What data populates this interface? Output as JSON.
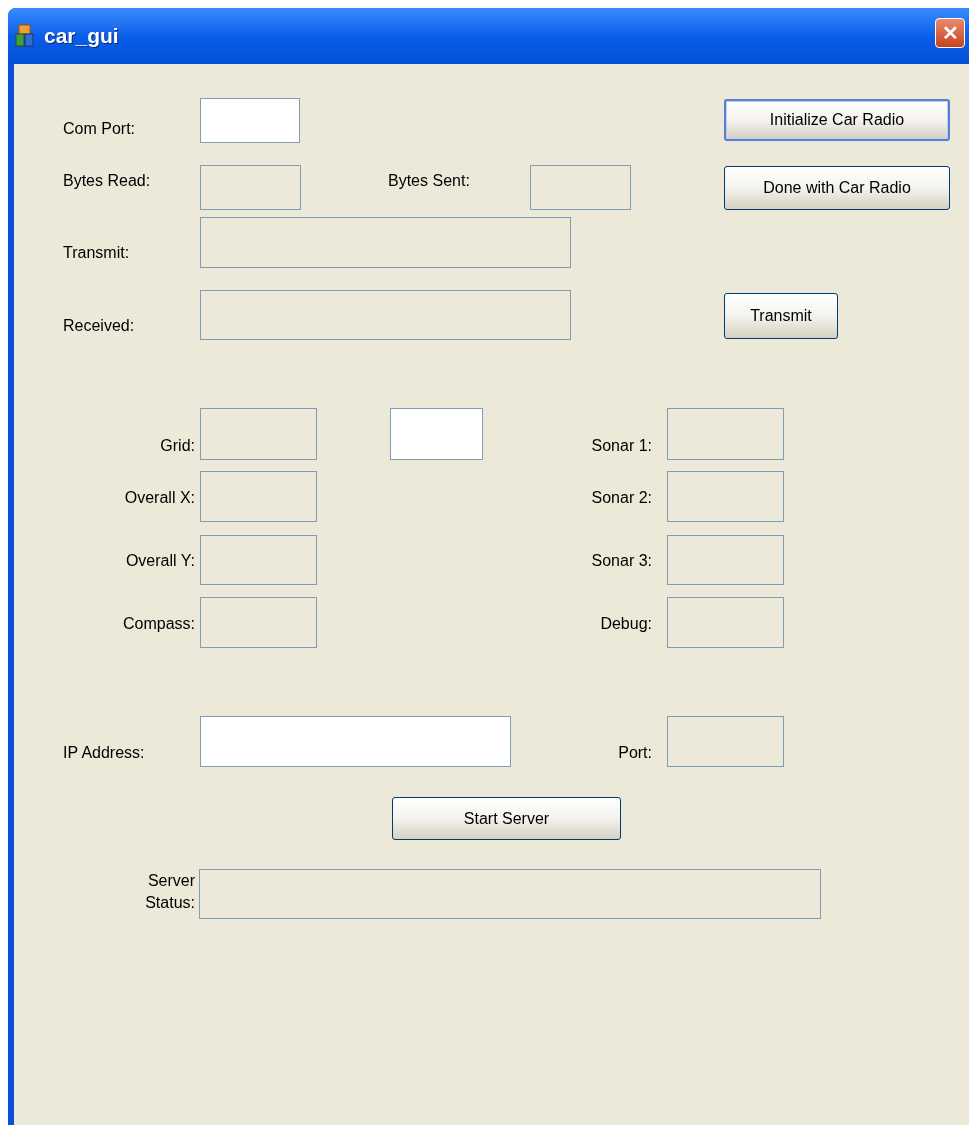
{
  "window": {
    "title": "car_gui",
    "close_symbol": "✕"
  },
  "controls": [
    {
      "kind": "label",
      "text": "Com Port:"
    },
    {
      "kind": "field",
      "editable": true
    },
    {
      "kind": "button",
      "text": "Initialize Car Radio",
      "focused": true
    },
    {
      "kind": "label",
      "text": "Bytes Read:"
    },
    {
      "kind": "field",
      "editable": false
    },
    {
      "kind": "label",
      "text": "Bytes Sent:"
    },
    {
      "kind": "field",
      "editable": false
    },
    {
      "kind": "button",
      "text": "Done with Car Radio",
      "focused": false
    },
    {
      "kind": "label",
      "text": "Transmit:"
    },
    {
      "kind": "field",
      "editable": false
    },
    {
      "kind": "label",
      "text": "Received:"
    },
    {
      "kind": "field",
      "editable": false
    },
    {
      "kind": "button",
      "text": "Transmit",
      "focused": false
    },
    {
      "kind": "label",
      "text": "Grid:"
    },
    {
      "kind": "field",
      "editable": false
    },
    {
      "kind": "field",
      "editable": true
    },
    {
      "kind": "label",
      "text": "Sonar 1:"
    },
    {
      "kind": "field",
      "editable": false
    },
    {
      "kind": "label",
      "text": "Overall X:"
    },
    {
      "kind": "field",
      "editable": false
    },
    {
      "kind": "label",
      "text": "Sonar 2:"
    },
    {
      "kind": "field",
      "editable": false
    },
    {
      "kind": "label",
      "text": "Overall Y:"
    },
    {
      "kind": "field",
      "editable": false
    },
    {
      "kind": "label",
      "text": "Sonar 3:"
    },
    {
      "kind": "field",
      "editable": false
    },
    {
      "kind": "label",
      "text": "Compass:"
    },
    {
      "kind": "field",
      "editable": false
    },
    {
      "kind": "label",
      "text": "Debug:"
    },
    {
      "kind": "field",
      "editable": false
    },
    {
      "kind": "label",
      "text": "IP Address:"
    },
    {
      "kind": "field",
      "editable": true
    },
    {
      "kind": "label",
      "text": "Port:"
    },
    {
      "kind": "field",
      "editable": false
    },
    {
      "kind": "button",
      "text": "Start Server",
      "focused": false
    },
    {
      "kind": "label",
      "text": "Server Status:"
    },
    {
      "kind": "field",
      "editable": false
    }
  ]
}
